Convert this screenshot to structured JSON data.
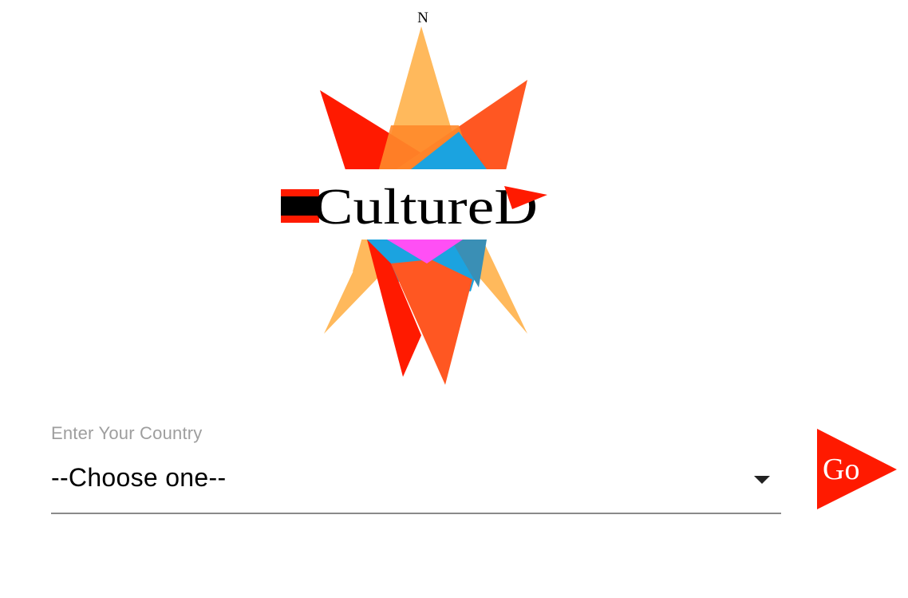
{
  "logo": {
    "compass_letter": "N",
    "wordmark": "CultureD",
    "colors": {
      "red": "#ff1a00",
      "orange": "#ff5722",
      "light_orange": "#ffb95c",
      "mid_orange": "#ff8a2a",
      "blue": "#1ba3e0",
      "pink": "#ff4ff5",
      "black": "#000000"
    }
  },
  "country_field": {
    "label": "Enter Your Country",
    "selected_value": "--Choose one--",
    "caret_icon": "caret-down-icon"
  },
  "go_button": {
    "label": "Go",
    "color": "#ff1a00",
    "icon": "play-triangle-icon"
  }
}
